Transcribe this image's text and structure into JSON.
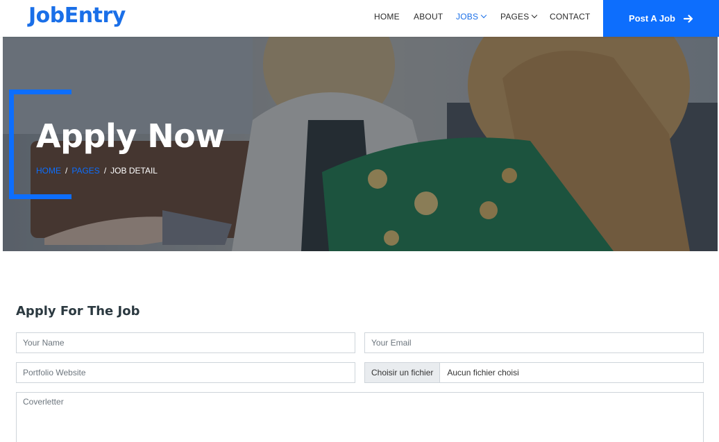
{
  "brand": {
    "name": "JobEntry"
  },
  "nav": {
    "items": [
      {
        "label": "HOME",
        "active": false,
        "dropdown": false
      },
      {
        "label": "ABOUT",
        "active": false,
        "dropdown": false
      },
      {
        "label": "JOBS",
        "active": true,
        "dropdown": true
      },
      {
        "label": "PAGES",
        "active": false,
        "dropdown": true
      },
      {
        "label": "CONTACT",
        "active": false,
        "dropdown": false
      }
    ],
    "cta_label": "Post A Job",
    "cta_icon": "arrow-right-icon"
  },
  "hero": {
    "title": "Apply Now",
    "breadcrumb": [
      "HOME",
      "PAGES",
      "JOB DETAIL"
    ],
    "breadcrumb_separator": "/"
  },
  "form": {
    "title": "Apply For The Job",
    "name_placeholder": "Your Name",
    "email_placeholder": "Your Email",
    "portfolio_placeholder": "Portfolio Website",
    "file_button_label": "Choisir un fichier",
    "file_status": "Aucun fichier choisi",
    "coverletter_placeholder": "Coverletter"
  },
  "colors": {
    "primary": "#0d6efd",
    "brand": "#1a6fe8",
    "heading": "#2b3940"
  }
}
